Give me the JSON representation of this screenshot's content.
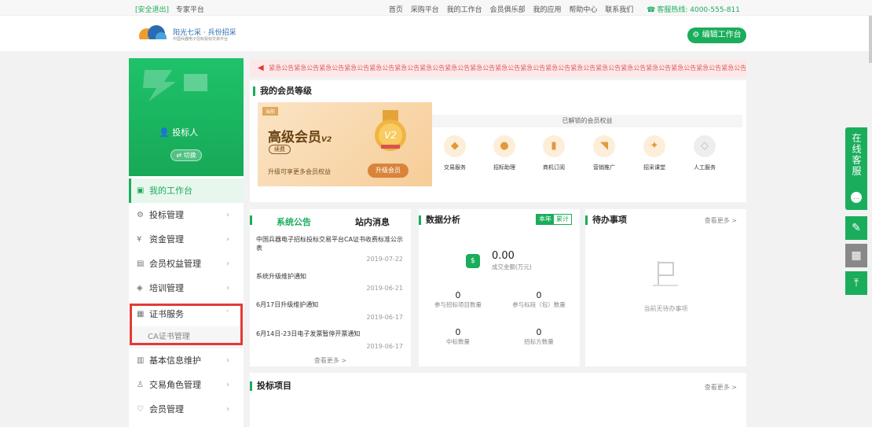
{
  "topbar": {
    "exit": "[安全退出]",
    "expert": "专家平台",
    "links": [
      "首页",
      "采购平台",
      "我的工作台",
      "会员俱乐部",
      "我的应用",
      "帮助中心",
      "联系我们"
    ],
    "hotline": "客服热线: 4000-555-811"
  },
  "header": {
    "logo_title": "阳光七采 · 兵份招采",
    "logo_sub": "中国兵器电子招标投标交易平台",
    "edit_button": "编辑工作台"
  },
  "sidebar": {
    "role": "投标人",
    "switch": "切换",
    "items": [
      {
        "label": "我的工作台",
        "icon": "workbench-icon"
      },
      {
        "label": "投标管理",
        "icon": "gear-icon"
      },
      {
        "label": "资金管理",
        "icon": "money-icon"
      },
      {
        "label": "会员权益管理",
        "icon": "doc-icon"
      },
      {
        "label": "培训管理",
        "icon": "training-icon"
      },
      {
        "label": "证书服务",
        "icon": "cert-icon"
      },
      {
        "label": "基本信息维护",
        "icon": "info-icon"
      },
      {
        "label": "交易角色管理",
        "icon": "user-icon"
      },
      {
        "label": "会员管理",
        "icon": "heart-icon"
      }
    ],
    "sub_item": "CA证书管理"
  },
  "notice": "紧急公告紧急公告紧急公告紧急公告紧急公告紧急公告紧急公告紧急公告紧急公告紧急公告紧急公告紧急公告紧急公告紧急公告紧急公告紧急公告紧急公告紧急公告紧急公告紧急公告紧急公告紧急公告紧急公告紧急公告紧急公告紧急公告紧急公告",
  "member": {
    "title": "我的会员等级",
    "tag": "当前",
    "level": "高级会员",
    "level_sub": "V2",
    "renew": "续费",
    "desc": "升级可享更多会员权益",
    "upgrade": "升级会员",
    "medal": "V2",
    "benefits_title": "已解锁的会员权益",
    "benefits": [
      "交易服务",
      "招标助理",
      "商机订阅",
      "营销推广",
      "招采课堂",
      "人工服务"
    ]
  },
  "announce": {
    "tab1": "系统公告",
    "tab2": "站内消息",
    "items": [
      {
        "text": "中国兵器电子招标投标交易平台CA证书收费标准公示表",
        "date": "2019-07-22"
      },
      {
        "text": "系统升级维护通知",
        "date": "2019-06-21"
      },
      {
        "text": "6月17日升级维护通知",
        "date": "2019-06-17"
      },
      {
        "text": "6月14日-23日电子发票暂停开票通知",
        "date": "2019-06-17"
      }
    ],
    "more": "查看更多 >"
  },
  "analysis": {
    "title": "数据分析",
    "seg_on": "本年",
    "seg_off": "累计",
    "amount": "0.00",
    "amount_label": "成交金额(万元)",
    "stats": [
      {
        "value": "0",
        "label": "参与招标项目数量"
      },
      {
        "value": "0",
        "label": "参与标段（包）数量"
      },
      {
        "value": "0",
        "label": "中标数量"
      },
      {
        "value": "0",
        "label": "招标方数量"
      }
    ]
  },
  "todo": {
    "title": "待办事项",
    "more": "查看更多 >",
    "empty": "当前无待办事项"
  },
  "projects": {
    "title": "投标项目",
    "more": "查看更多 >"
  },
  "rightbar": {
    "service": "在线客服"
  },
  "colors": {
    "accent": "#1aad5b",
    "alert": "#e53935"
  }
}
